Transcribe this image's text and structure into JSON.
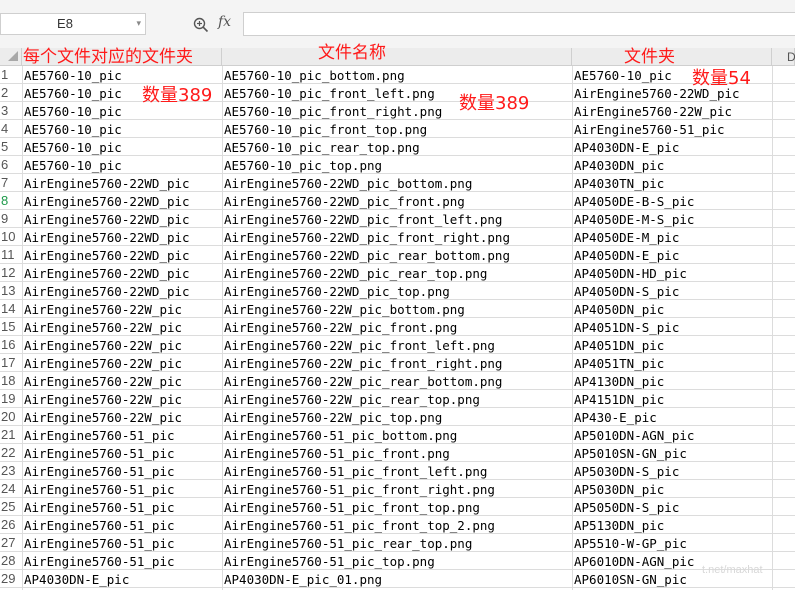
{
  "name_box": {
    "value": "E8"
  },
  "formula_bar": {
    "fx_label": "fx",
    "value": ""
  },
  "header_labels": {
    "col_a": "每个文件对应的文件夹",
    "col_b": "文件名称",
    "col_c": "文件夹",
    "col_d": "D"
  },
  "annotations": {
    "count_a": "数量389",
    "count_b": "数量389",
    "count_c": "数量54"
  },
  "selected_row": 8,
  "rows": [
    {
      "num": "1",
      "a": "AE5760-10_pic",
      "b": "AE5760-10_pic_bottom.png",
      "c": "AE5760-10_pic"
    },
    {
      "num": "2",
      "a": "AE5760-10_pic",
      "b": "AE5760-10_pic_front_left.png",
      "c": "AirEngine5760-22WD_pic"
    },
    {
      "num": "3",
      "a": "AE5760-10_pic",
      "b": "AE5760-10_pic_front_right.png",
      "c": "AirEngine5760-22W_pic"
    },
    {
      "num": "4",
      "a": "AE5760-10_pic",
      "b": "AE5760-10_pic_front_top.png",
      "c": "AirEngine5760-51_pic"
    },
    {
      "num": "5",
      "a": "AE5760-10_pic",
      "b": "AE5760-10_pic_rear_top.png",
      "c": "AP4030DN-E_pic"
    },
    {
      "num": "6",
      "a": "AE5760-10_pic",
      "b": "AE5760-10_pic_top.png",
      "c": "AP4030DN_pic"
    },
    {
      "num": "7",
      "a": "AirEngine5760-22WD_pic",
      "b": "AirEngine5760-22WD_pic_bottom.png",
      "c": "AP4030TN_pic"
    },
    {
      "num": "8",
      "a": "AirEngine5760-22WD_pic",
      "b": "AirEngine5760-22WD_pic_front.png",
      "c": "AP4050DE-B-S_pic"
    },
    {
      "num": "9",
      "a": "AirEngine5760-22WD_pic",
      "b": "AirEngine5760-22WD_pic_front_left.png",
      "c": "AP4050DE-M-S_pic"
    },
    {
      "num": "10",
      "a": "AirEngine5760-22WD_pic",
      "b": "AirEngine5760-22WD_pic_front_right.png",
      "c": "AP4050DE-M_pic"
    },
    {
      "num": "11",
      "a": "AirEngine5760-22WD_pic",
      "b": "AirEngine5760-22WD_pic_rear_bottom.png",
      "c": "AP4050DN-E_pic"
    },
    {
      "num": "12",
      "a": "AirEngine5760-22WD_pic",
      "b": "AirEngine5760-22WD_pic_rear_top.png",
      "c": "AP4050DN-HD_pic"
    },
    {
      "num": "13",
      "a": "AirEngine5760-22WD_pic",
      "b": "AirEngine5760-22WD_pic_top.png",
      "c": "AP4050DN-S_pic"
    },
    {
      "num": "14",
      "a": "AirEngine5760-22W_pic",
      "b": "AirEngine5760-22W_pic_bottom.png",
      "c": "AP4050DN_pic"
    },
    {
      "num": "15",
      "a": "AirEngine5760-22W_pic",
      "b": "AirEngine5760-22W_pic_front.png",
      "c": "AP4051DN-S_pic"
    },
    {
      "num": "16",
      "a": "AirEngine5760-22W_pic",
      "b": "AirEngine5760-22W_pic_front_left.png",
      "c": "AP4051DN_pic"
    },
    {
      "num": "17",
      "a": "AirEngine5760-22W_pic",
      "b": "AirEngine5760-22W_pic_front_right.png",
      "c": "AP4051TN_pic"
    },
    {
      "num": "18",
      "a": "AirEngine5760-22W_pic",
      "b": "AirEngine5760-22W_pic_rear_bottom.png",
      "c": "AP4130DN_pic"
    },
    {
      "num": "19",
      "a": "AirEngine5760-22W_pic",
      "b": "AirEngine5760-22W_pic_rear_top.png",
      "c": "AP4151DN_pic"
    },
    {
      "num": "20",
      "a": "AirEngine5760-22W_pic",
      "b": "AirEngine5760-22W_pic_top.png",
      "c": "AP430-E_pic"
    },
    {
      "num": "21",
      "a": "AirEngine5760-51_pic",
      "b": "AirEngine5760-51_pic_bottom.png",
      "c": "AP5010DN-AGN_pic"
    },
    {
      "num": "22",
      "a": "AirEngine5760-51_pic",
      "b": "AirEngine5760-51_pic_front.png",
      "c": "AP5010SN-GN_pic"
    },
    {
      "num": "23",
      "a": "AirEngine5760-51_pic",
      "b": "AirEngine5760-51_pic_front_left.png",
      "c": "AP5030DN-S_pic"
    },
    {
      "num": "24",
      "a": "AirEngine5760-51_pic",
      "b": "AirEngine5760-51_pic_front_right.png",
      "c": "AP5030DN_pic"
    },
    {
      "num": "25",
      "a": "AirEngine5760-51_pic",
      "b": "AirEngine5760-51_pic_front_top.png",
      "c": "AP5050DN-S_pic"
    },
    {
      "num": "26",
      "a": "AirEngine5760-51_pic",
      "b": "AirEngine5760-51_pic_front_top_2.png",
      "c": "AP5130DN_pic"
    },
    {
      "num": "27",
      "a": "AirEngine5760-51_pic",
      "b": "AirEngine5760-51_pic_rear_top.png",
      "c": "AP5510-W-GP_pic"
    },
    {
      "num": "28",
      "a": "AirEngine5760-51_pic",
      "b": "AirEngine5760-51_pic_top.png",
      "c": "AP6010DN-AGN_pic"
    },
    {
      "num": "29",
      "a": "AP4030DN-E_pic",
      "b": "AP4030DN-E_pic_01.png",
      "c": "AP6010SN-GN_pic"
    }
  ],
  "watermark": "t.net/maxhat"
}
